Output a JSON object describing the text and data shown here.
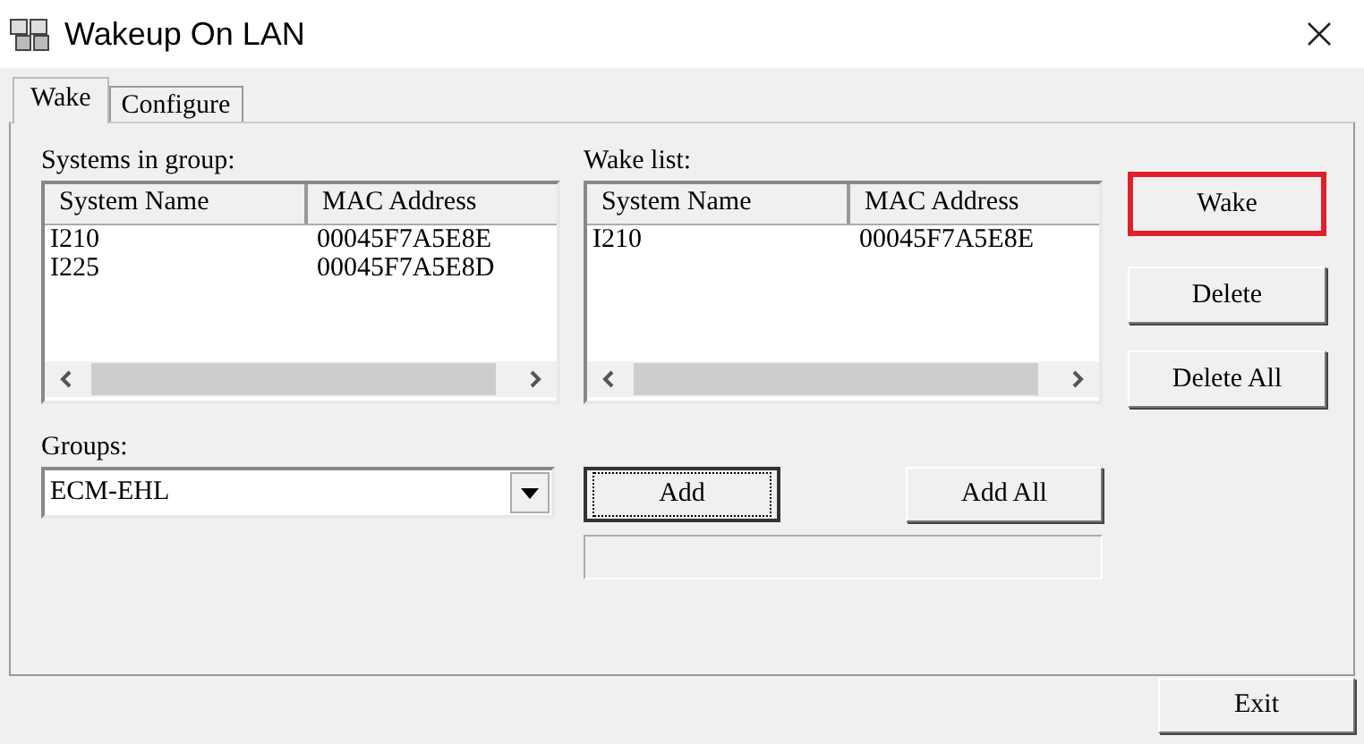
{
  "window": {
    "title": "Wakeup On LAN"
  },
  "tabs": [
    {
      "label": "Wake",
      "selected": true
    },
    {
      "label": "Configure",
      "selected": false
    }
  ],
  "lists": [
    {
      "label": "Systems in group:",
      "columns": [
        "System Name",
        "MAC Address"
      ],
      "rows": [
        [
          "I210",
          "00045F7A5E8E"
        ],
        [
          "I225",
          "00045F7A5E8D"
        ]
      ]
    },
    {
      "label": "Wake list:",
      "columns": [
        "System Name",
        "MAC Address"
      ],
      "rows": [
        [
          "I210",
          "00045F7A5E8E"
        ]
      ]
    }
  ],
  "side_buttons": [
    {
      "label": "Wake",
      "highlighted": true
    },
    {
      "label": "Delete",
      "highlighted": false
    },
    {
      "label": "Delete All",
      "highlighted": false
    }
  ],
  "groups": {
    "label": "Groups:",
    "value": "ECM-EHL"
  },
  "add_buttons": [
    {
      "label": "Add",
      "focused": true
    },
    {
      "label": "Add All",
      "focused": false
    }
  ],
  "progress": {
    "level": 0
  },
  "exit_button": {
    "label": "Exit"
  }
}
